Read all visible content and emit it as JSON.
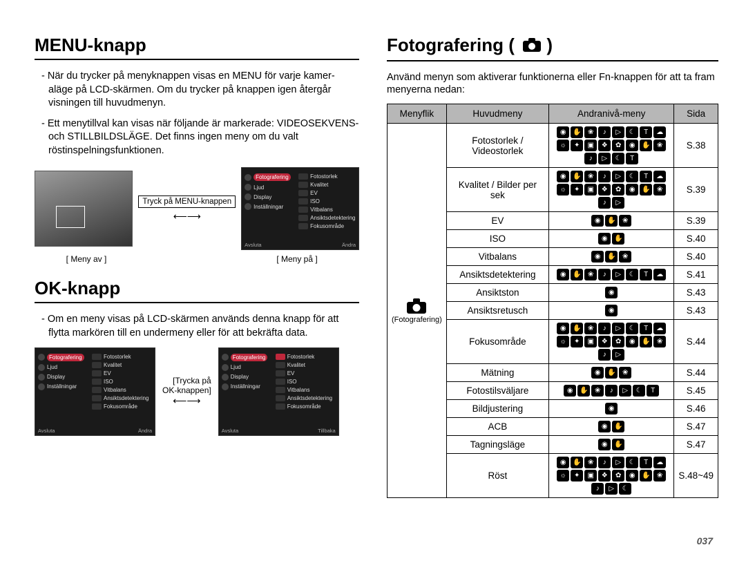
{
  "page_number": "037",
  "left": {
    "heading_menu": "MENU-knapp",
    "menu_para1": "- När du trycker på menyknappen visas en MENU för varje kamer-aläge på LCD-skärmen. Om du trycker på knappen igen återgår visningen till huvudmenyn.",
    "menu_para2": "- Ett menytillval kan visas när följande är markerade: VIDEOSEKVENS- och STILLBILDSLÄGE. Det finns ingen meny om du valt röstinspelningsfunktionen.",
    "press_menu_label": "Tryck på MENU-knappen",
    "caption_off": "[ Meny av ]",
    "caption_on": "[ Meny på ]",
    "heading_ok": "OK-knapp",
    "ok_para": "- Om en meny visas på LCD-skärmen används denna knapp för att flytta markören till en undermeny eller för att bekräfta data.",
    "press_ok_line1": "[Trycka på",
    "press_ok_line2": "OK-knappen]",
    "menu_side_items": [
      "Fotografering",
      "Ljud",
      "Display",
      "Inställningar"
    ],
    "menu_right_items": [
      "Fotostorlek",
      "Kvalitet",
      "EV",
      "ISO",
      "Vitbalans",
      "Ansiktsdetektering",
      "Fokusområde"
    ],
    "menu_bottom_left": "Avsluta",
    "menu_bottom_right_andra": "Ändra",
    "menu_bottom_right_tillbaka": "Tillbaka"
  },
  "right": {
    "heading": "Fotografering (",
    "heading_close": " )",
    "intro": "Använd menyn som aktiverar funktionerna eller Fn-knappen för att ta fram menyerna nedan:",
    "th_flik": "Menyflik",
    "th_huvud": "Huvudmeny",
    "th_andra": "Andranivå-meny",
    "th_sida": "Sida",
    "flik_label": "(Fotografering)",
    "rows": [
      {
        "label": "Fotostorlek / Videostorlek",
        "iconrows": 2,
        "icons": 20,
        "page": "S.38"
      },
      {
        "label": "Kvalitet / Bilder per sek",
        "iconrows": 2,
        "icons": 18,
        "page": "S.39"
      },
      {
        "label": "EV",
        "iconrows": 1,
        "icons": 3,
        "page": "S.39"
      },
      {
        "label": "ISO",
        "iconrows": 1,
        "icons": 2,
        "page": "S.40"
      },
      {
        "label": "Vitbalans",
        "iconrows": 1,
        "icons": 3,
        "page": "S.40"
      },
      {
        "label": "Ansiktsdetektering",
        "iconrows": 1,
        "icons": 8,
        "page": "S.41"
      },
      {
        "label": "Ansiktston",
        "iconrows": 1,
        "icons": 1,
        "page": "S.43"
      },
      {
        "label": "Ansiktsretusch",
        "iconrows": 1,
        "icons": 1,
        "page": "S.43"
      },
      {
        "label": "Fokusområde",
        "iconrows": 2,
        "icons": 18,
        "page": "S.44"
      },
      {
        "label": "Mätning",
        "iconrows": 1,
        "icons": 3,
        "page": "S.44"
      },
      {
        "label": "Fotostilsväljare",
        "iconrows": 1,
        "icons": 7,
        "page": "S.45"
      },
      {
        "label": "Bildjustering",
        "iconrows": 1,
        "icons": 1,
        "page": "S.46"
      },
      {
        "label": "ACB",
        "iconrows": 1,
        "icons": 2,
        "page": "S.47"
      },
      {
        "label": "Tagningsläge",
        "iconrows": 1,
        "icons": 2,
        "page": "S.47"
      },
      {
        "label": "Röst",
        "iconrows": 2,
        "icons": 19,
        "page": "S.48~49"
      }
    ]
  }
}
